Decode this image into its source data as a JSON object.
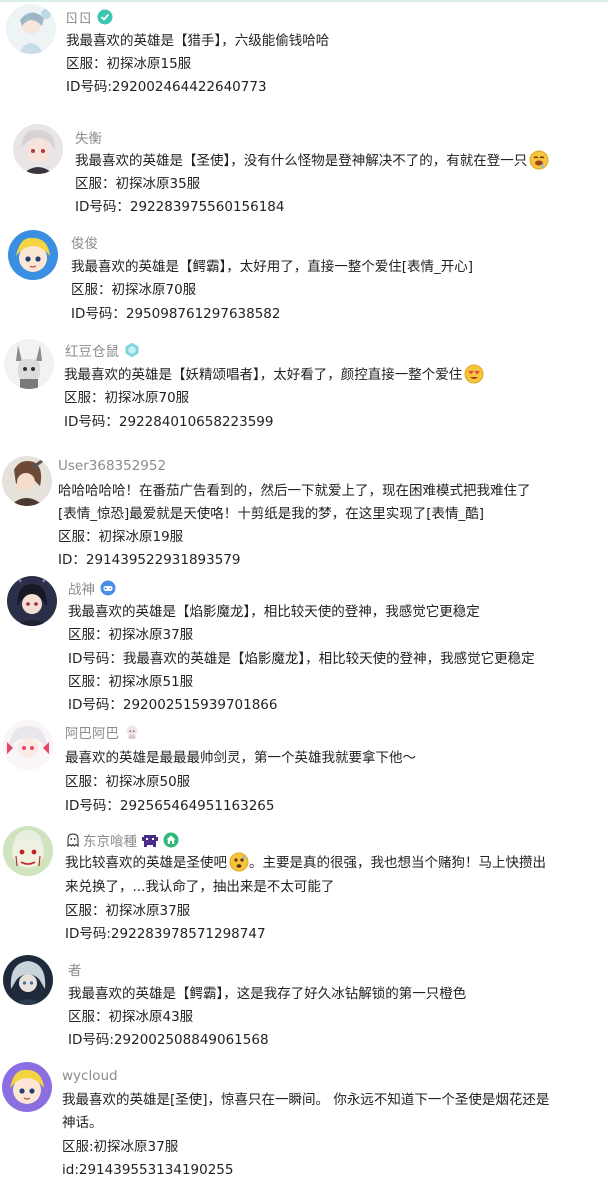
{
  "comments": [
    {
      "username": "ㄖㄖ",
      "lines": [
        "我最喜欢的英雄是【猎手】，六级能偷钱哈哈",
        "区服：初探冰原15服",
        "ID号码:292002464422640773"
      ]
    },
    {
      "username": "失衡",
      "lines": [
        "我最喜欢的英雄是【圣使】，没有什么怪物是登神解决不了的，有就在登一只",
        "区服：初探冰原35服",
        "ID号码：292283975560156184"
      ]
    },
    {
      "username": "俊俊",
      "lines": [
        "我最喜欢的英雄是【鳄霸】，太好用了，直接一整个爱住[表情_开心]",
        "区服：初探冰原70服",
        "ID号码：295098761297638582"
      ]
    },
    {
      "username": "红豆仓鼠",
      "lines": [
        "我最喜欢的英雄是【妖精颂唱者】，太好看了，颜控直接一整个爱住",
        "区服：初探冰原70服",
        "ID号码：292284010658223599"
      ]
    },
    {
      "username": "User368352952",
      "lines": [
        "哈哈哈哈哈！在番茄广告看到的，然后一下就爱上了，现在困难模式把我难住了",
        "[表情_惊恐]最爱就是天使咯！十剪纸是我的梦，在这里实现了[表情_酷]",
        "区服：初探冰原19服",
        "ID：291439522931893579"
      ]
    },
    {
      "username": "战神",
      "lines": [
        "我最喜欢的英雄是【焰影魔龙】，相比较天使的登神，我感觉它更稳定",
        "区服：初探冰原37服",
        "ID号码：我最喜欢的英雄是【焰影魔龙】，相比较天使的登神，我感觉它更稳定",
        "区服：初探冰原51服",
        "ID号码：292002515939701866"
      ]
    },
    {
      "username": "阿巴阿巴",
      "lines": [
        "最喜欢的英雄是最最最帅剑灵，第一个英雄我就要拿下他～",
        "区服：初探冰原50服",
        "ID号码：292565464951163265"
      ]
    },
    {
      "username": "东京喰種",
      "lines": [
        "我比较喜欢的英雄是圣使吧",
        "来兑换了，...我认命了，抽出来是不太可能了",
        "区服：初探冰原37服",
        "ID号码:292283978571298747"
      ]
    },
    {
      "username": "者",
      "lines": [
        "我最喜欢的英雄是【鳄霸】，这是我存了好久冰钻解锁的第一只橙色",
        "区服：初探冰原43服",
        "ID号码:292002508849061568"
      ]
    },
    {
      "username": "wycloud",
      "lines": [
        "我最喜欢的英雄是[圣使]，惊喜只在一瞬间。 你永远不知道下一个圣使是烟花还是",
        "神话。",
        "区服:初探冰原37服",
        "id:291439553134190255"
      ]
    }
  ],
  "inline_tail": {
    "c8_line1": "。主要是真的很强，我也想当个赌狗！马上快攒出"
  },
  "icons": {
    "badge_level": "level-badge-icon",
    "badge_gamepad": "gamepad-badge-icon",
    "badge_home": "home-badge-icon",
    "emoji_drool": "drool-emoji-icon",
    "emoji_heart_eyes": "heart-eyes-emoji-icon",
    "emoji_scared": "scared-emoji-icon"
  },
  "colors": {
    "username": "#8c8c8c",
    "text": "#222222",
    "badge_teal": "#3ec5b0",
    "badge_blue": "#4a8fe7",
    "badge_green": "#2fb87a",
    "emoji_yellow": "#f7c53c"
  }
}
